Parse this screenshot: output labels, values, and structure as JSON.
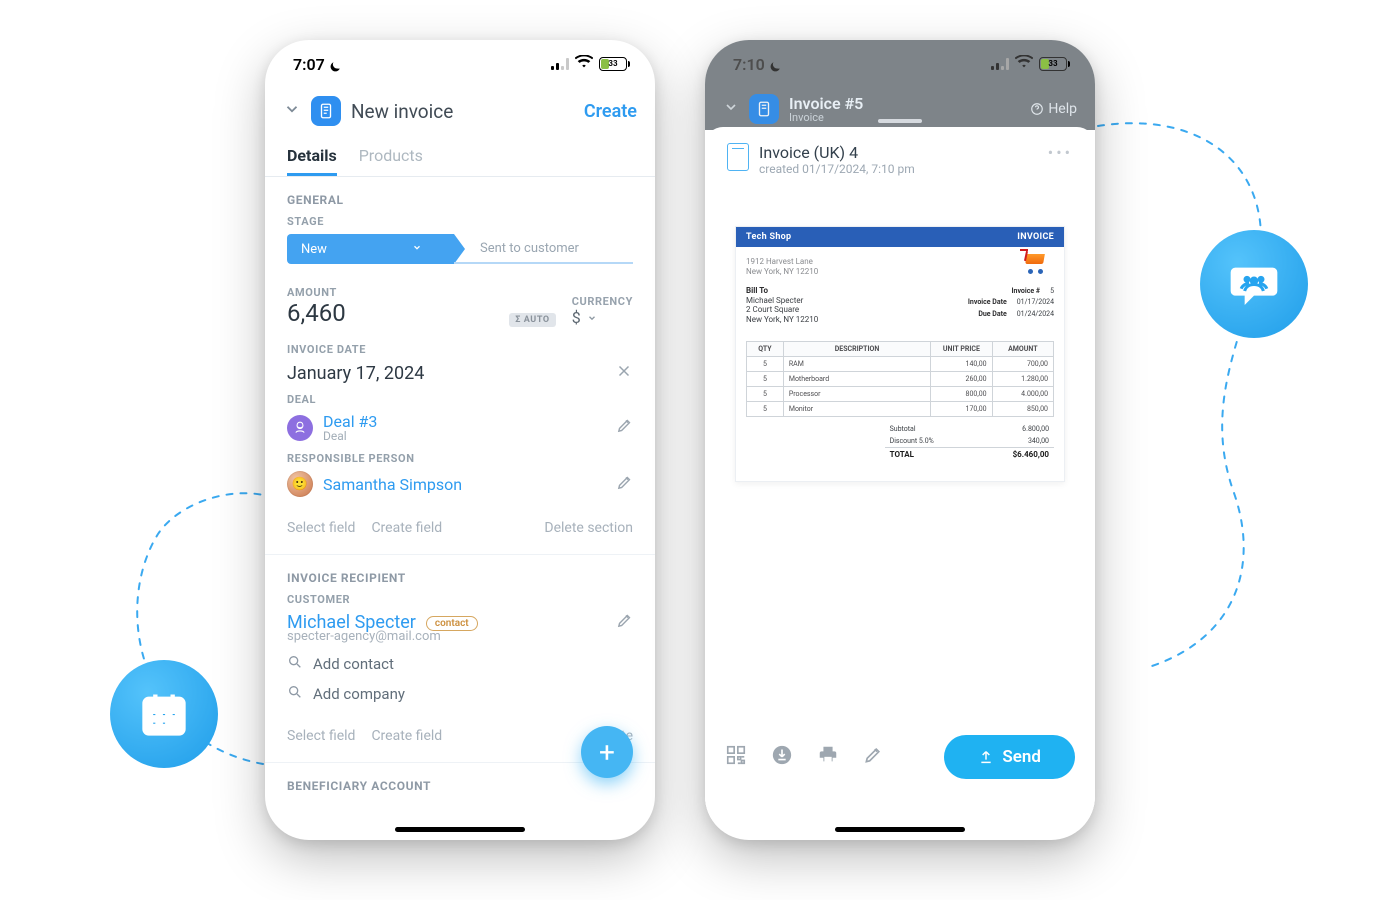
{
  "status": {
    "left_time": "7:07",
    "right_time": "7:10",
    "battery_pct": "33",
    "battery_fill_pct": 33
  },
  "leftPhone": {
    "header": {
      "title": "New invoice",
      "create": "Create"
    },
    "tabs": {
      "details": "Details",
      "products": "Products"
    },
    "sections": {
      "general_title": "GENERAL",
      "stage_label": "STAGE",
      "stages": {
        "active": "New",
        "next": "Sent to customer"
      },
      "amount_label": "AMOUNT",
      "amount_value": "6,460",
      "auto_chip": "Σ AUTO",
      "currency_label": "CURRENCY",
      "currency_symbol": "$",
      "invoice_date_label": "INVOICE DATE",
      "invoice_date": "January 17, 2024",
      "deal_label": "DEAL",
      "deal_name": "Deal #3",
      "deal_sub": "Deal",
      "responsible_label": "RESPONSIBLE PERSON",
      "responsible_name": "Samantha Simpson",
      "select_field": "Select field",
      "create_field": "Create field",
      "delete_section": "Delete section",
      "recipient_title": "INVOICE RECIPIENT",
      "customer_label": "CUSTOMER",
      "customer_name": "Michael Specter",
      "contact_tag": "contact",
      "customer_email": "specter-agency@mail.com",
      "add_contact": "Add contact",
      "add_company": "Add company",
      "select_field2": "Select field",
      "create_field2": "Create field",
      "delete_section2": "Delete",
      "beneficiary_title": "BENEFICIARY ACCOUNT"
    }
  },
  "rightPhone": {
    "header": {
      "title": "Invoice #5",
      "sub": "Invoice",
      "help": "Help"
    },
    "sheet": {
      "title": "Invoice (UK) 4",
      "created": "created 01/17/2024, 7:10 pm"
    },
    "invoice": {
      "brand": "Tech Shop",
      "doc_type": "INVOICE",
      "from_addr1": "1912 Harvest Lane",
      "from_addr2": "New York, NY 12210",
      "bill_to_label": "Bill To",
      "bill_name": "Michael Specter",
      "bill_addr1": "2 Court Square",
      "bill_addr2": "New York, NY 12210",
      "meta": {
        "invnum_label": "Invoice #",
        "invnum": "5",
        "invdate_label": "Invoice Date",
        "invdate": "01/17/2024",
        "due_label": "Due Date",
        "due": "01/24/2024"
      },
      "columns": {
        "qty": "QTY",
        "desc": "DESCRIPTION",
        "unit": "UNIT PRICE",
        "amt": "AMOUNT"
      },
      "rows": [
        {
          "qty": "5",
          "desc": "RAM",
          "unit": "140,00",
          "amt": "700,00"
        },
        {
          "qty": "5",
          "desc": "Motherboard",
          "unit": "260,00",
          "amt": "1.280,00"
        },
        {
          "qty": "5",
          "desc": "Processor",
          "unit": "800,00",
          "amt": "4.000,00"
        },
        {
          "qty": "5",
          "desc": "Monitor",
          "unit": "170,00",
          "amt": "850,00"
        }
      ],
      "totals": {
        "subtotal_label": "Subtotal",
        "subtotal": "6.800,00",
        "discount_label": "Discount 5.0%",
        "discount": "340,00",
        "total_label": "TOTAL",
        "total": "$6.460,00"
      }
    },
    "bottom": {
      "send": "Send"
    }
  }
}
